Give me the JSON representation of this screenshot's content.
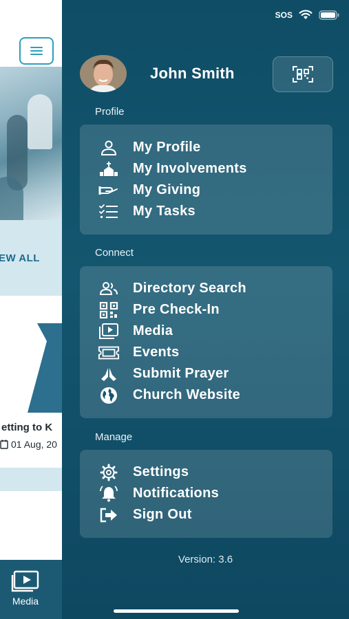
{
  "background": {
    "view_all": "EW ALL",
    "card_title": "etting to K",
    "card_date": "01 Aug, 20",
    "tab_media": "Media"
  },
  "status_bar": {
    "carrier": "SOS"
  },
  "drawer": {
    "user_name": "John Smith",
    "sections": [
      {
        "label": "Profile",
        "items": [
          {
            "label": "My Profile",
            "icon": "person-icon"
          },
          {
            "label": "My Involvements",
            "icon": "church-icon"
          },
          {
            "label": "My Giving",
            "icon": "giving-hand-icon"
          },
          {
            "label": "My Tasks",
            "icon": "task-list-icon"
          }
        ]
      },
      {
        "label": "Connect",
        "items": [
          {
            "label": "Directory Search",
            "icon": "people-icon"
          },
          {
            "label": "Pre Check-In",
            "icon": "qr-code-icon"
          },
          {
            "label": "Media",
            "icon": "media-play-icon"
          },
          {
            "label": "Events",
            "icon": "ticket-icon"
          },
          {
            "label": "Submit Prayer",
            "icon": "praying-hands-icon"
          },
          {
            "label": "Church Website",
            "icon": "globe-icon"
          }
        ]
      },
      {
        "label": "Manage",
        "items": [
          {
            "label": "Settings",
            "icon": "gear-icon"
          },
          {
            "label": "Notifications",
            "icon": "bell-icon"
          },
          {
            "label": "Sign Out",
            "icon": "sign-out-icon"
          }
        ]
      }
    ],
    "version": "Version: 3.6"
  },
  "colors": {
    "drawer_bg": "#0f4d66",
    "panel_bg": "rgba(255,255,255,0.14)",
    "accent": "#2aa0c0",
    "tabbar_bg": "#1c5a74"
  }
}
